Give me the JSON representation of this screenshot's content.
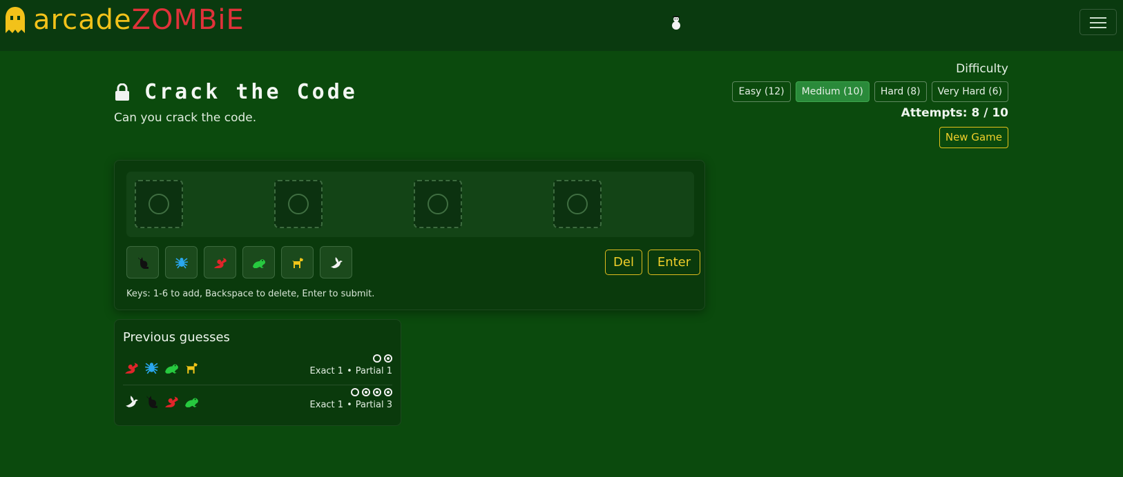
{
  "navbar": {
    "brand_part1": "arcade",
    "brand_part2": "ZOMBiE",
    "menu_icon": "hamburger-icon",
    "center_icon": "snowman-icon"
  },
  "game": {
    "title": "Crack the Code",
    "subtitle": "Can you crack the code.",
    "lock_icon": "lock-icon"
  },
  "difficulty": {
    "label": "Difficulty",
    "options": [
      {
        "label": "Easy (12)",
        "active": false
      },
      {
        "label": "Medium (10)",
        "active": true
      },
      {
        "label": "Hard (8)",
        "active": false
      },
      {
        "label": "Very Hard (6)",
        "active": false
      }
    ]
  },
  "attempts": "Attempts: 8 / 10",
  "new_game_label": "New Game",
  "slots": [
    {
      "filled": false
    },
    {
      "filled": false
    },
    {
      "filled": false
    },
    {
      "filled": false
    }
  ],
  "keys": [
    {
      "icon": "cat-icon",
      "color": "#111111"
    },
    {
      "icon": "spider-icon",
      "color": "#2aa7ee"
    },
    {
      "icon": "dragon-icon",
      "color": "#e0252a"
    },
    {
      "icon": "frog-icon",
      "color": "#27c93f"
    },
    {
      "icon": "dog-icon",
      "color": "#f0c419"
    },
    {
      "icon": "dove-icon",
      "color": "#f2f2f2"
    }
  ],
  "actions": {
    "delete": "Del",
    "enter": "Enter"
  },
  "hint": "Keys: 1-6 to add, Backspace to delete, Enter to submit.",
  "previous": {
    "title": "Previous guesses",
    "guesses": [
      {
        "icons": [
          "dragon-icon",
          "spider-icon",
          "frog-icon",
          "dog-icon"
        ],
        "pegs": [
          "exact",
          "partial"
        ],
        "exact_label": "Exact 1",
        "separator": "•",
        "partial_label": "Partial 1"
      },
      {
        "icons": [
          "dove-icon",
          "cat-icon",
          "dragon-icon",
          "frog-icon"
        ],
        "pegs": [
          "exact",
          "partial",
          "partial",
          "partial"
        ],
        "exact_label": "Exact 1",
        "separator": "•",
        "partial_label": "Partial 3"
      }
    ]
  },
  "colors": {
    "background": "#0b4a0d",
    "navbar": "#0a3a0f",
    "accent_yellow": "#f2c21a",
    "accent_red": "#e0323a",
    "active_button": "#2a8a3a"
  }
}
